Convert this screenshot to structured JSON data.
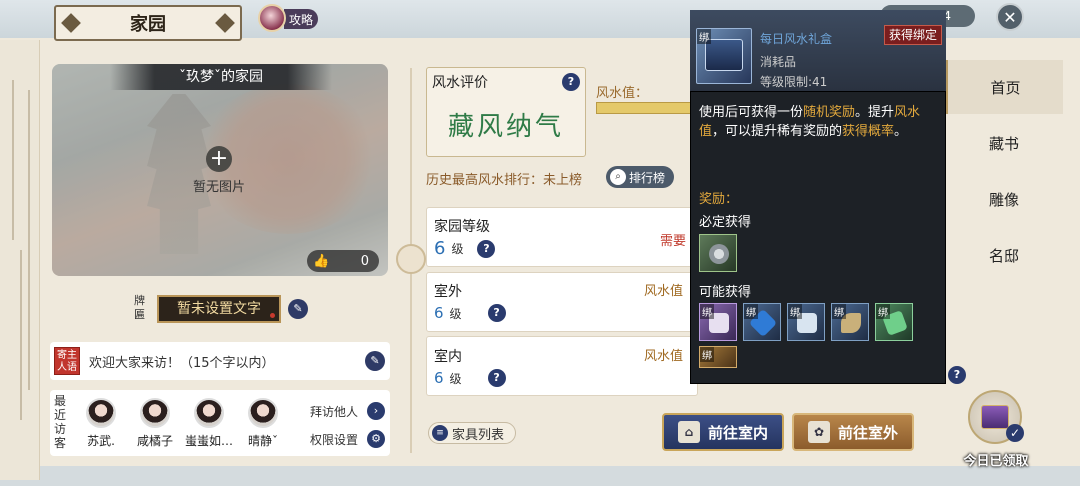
{
  "header": {
    "title": "家园",
    "guide_label": "攻略",
    "counter": "134"
  },
  "home": {
    "photo_title": "ˇ玖梦ˇ的家园",
    "no_photo": "暂无图片",
    "likes": "0",
    "plaque_label": "牌匾",
    "plaque_text": "暂未设置文字",
    "host_badge": "寄主人语",
    "welcome": "欢迎大家来访！（15个字以内）",
    "visitors_label": "最近访客",
    "visitors": [
      "苏武.",
      "咸橘子",
      "蚩蚩如…",
      "晴静ˇ"
    ],
    "visit_others": "拜访他人",
    "permission": "权限设置"
  },
  "fengshui": {
    "heading": "风水评价",
    "calligraphy": "藏风纳气",
    "value_label": "风水值：",
    "rank_text": "历史最高风水排行：未上榜",
    "rank_button": "排行榜",
    "bar_fill": 1.0
  },
  "stats": {
    "level_title": "家园等级",
    "level_value": "6",
    "level_unit": "级",
    "level_req": "需要",
    "outdoor_title": "室外",
    "outdoor_value": "6",
    "outdoor_unit": "级",
    "outdoor_fs": "风水值",
    "indoor_title": "室内",
    "indoor_value": "6",
    "indoor_unit": "级",
    "indoor_fs": "风水值"
  },
  "buttons": {
    "furniture": "家具列表",
    "go_inside": "前往室内",
    "go_outside": "前往室外"
  },
  "nav": [
    "首页",
    "藏书",
    "雕像",
    "名邸"
  ],
  "daily": {
    "label": "今日已领取"
  },
  "tooltip": {
    "name": "每日风水礼盒",
    "type": "消耗品",
    "level": "等级限制:41",
    "bound": "获得绑定",
    "bind_tag": "绑",
    "desc_1": "使用后可获得一份",
    "desc_hl1": "随机奖励",
    "desc_2": "。提升",
    "desc_hl2": "风水值",
    "desc_3": "，可以提升稀有奖励的",
    "desc_hl3": "获得概率",
    "desc_4": "。",
    "reward_label": "奖励：",
    "must_label": "必定获得",
    "may_label": "可能获得"
  },
  "colors": {
    "accent_gold": "#e3a93d",
    "level_blue": "#2c6fb3",
    "callig_green": "#2f7b47",
    "go_in_blue": "#2f4170",
    "go_out_brown": "#a2703a"
  }
}
